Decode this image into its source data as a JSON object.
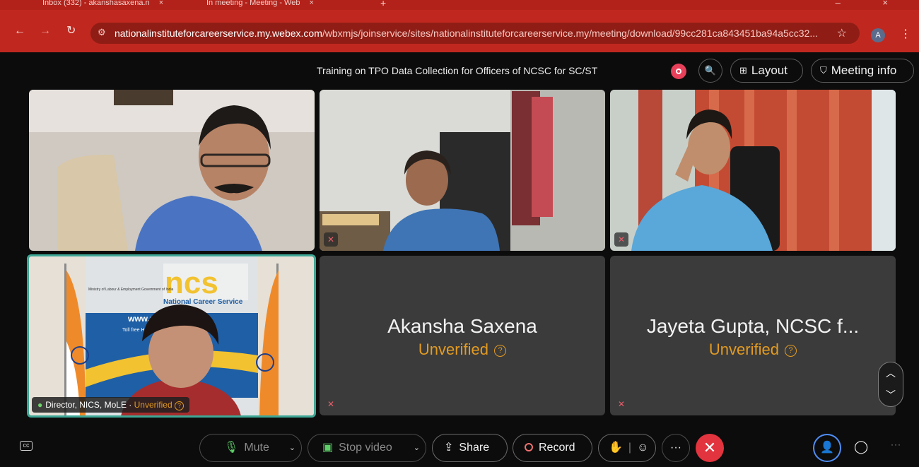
{
  "browser": {
    "tabs": [
      {
        "title": "Inbox (332) - akanshasaxena.n",
        "close": "×"
      },
      {
        "title": "In meeting - Meeting - Web",
        "close": "×"
      }
    ],
    "new_tab": "+",
    "url_host": "nationalinstituteforcareerservice.my.webex.com",
    "url_path": "/wbxmjs/joinservice/sites/nationalinstituteforcareerservice.my/meeting/download/99cc281ca843451ba94a5cc32...",
    "profile_initial": "A"
  },
  "meeting": {
    "title": "Training on TPO Data Collection for Officers of NCSC for SC/ST",
    "layout_label": "Layout",
    "info_label": "Meeting info",
    "tiles": [
      {
        "name": "",
        "status": ""
      },
      {
        "name": "",
        "status": ""
      },
      {
        "name": "",
        "status": ""
      },
      {
        "name": "Director, NICS, MoLE",
        "status": "Unverified"
      },
      {
        "name": "Akansha Saxena",
        "status": "Unverified"
      },
      {
        "name": "Jayeta Gupta, NCSC f...",
        "status": "Unverified"
      }
    ],
    "banner": {
      "logo_text": "ncs",
      "subtitle": "National Career Service",
      "website": "www.ncs.g",
      "helpline": "Toll free Helpline:",
      "ministry": "Ministry of Labour & Employment Government of India"
    }
  },
  "toolbar": {
    "mute_label": "Mute",
    "video_label": "Stop video",
    "share_label": "Share",
    "record_label": "Record",
    "more_label": "···",
    "overflow_label": "···"
  },
  "colors": {
    "browser_red": "#c0281f",
    "unverified_orange": "#e39b21",
    "active_speaker": "#3ea796",
    "leave_red": "#e2343e",
    "participants_blue": "#4f8ef7"
  },
  "icons": [
    "back-icon",
    "forward-icon",
    "reload-icon",
    "tune-icon",
    "star-icon",
    "kebab-icon",
    "record-indicator-icon",
    "zoom-icon",
    "layout-icon",
    "shield-icon",
    "mic-off-icon",
    "mic-icon",
    "camera-icon",
    "share-icon",
    "raise-hand-icon",
    "emoji-icon",
    "close-icon",
    "participants-icon",
    "chat-icon",
    "captions-icon",
    "chevron-up-icon",
    "chevron-down-icon"
  ]
}
